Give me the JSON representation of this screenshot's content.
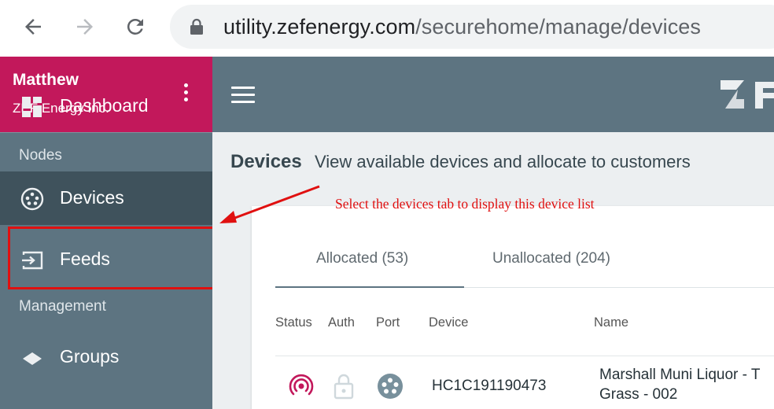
{
  "browser": {
    "url_host": "utility.zefenergy.com",
    "url_path": "/securehome/manage/devices",
    "icons": [
      "back-icon",
      "forward-icon",
      "reload-icon",
      "lock-icon"
    ]
  },
  "account": {
    "name": "Matthew",
    "org": "ZEF Energy Inc."
  },
  "sidebar": {
    "items": [
      {
        "label": "Dashboard",
        "icon": "dashboard-icon"
      },
      {
        "label": "Devices",
        "icon": "devices-icon",
        "active": true
      },
      {
        "label": "Feeds",
        "icon": "feeds-icon"
      },
      {
        "label": "Groups",
        "icon": "groups-icon"
      }
    ],
    "sections": {
      "nodes": "Nodes",
      "management": "Management"
    }
  },
  "page": {
    "title": "Devices",
    "subtitle": "View available devices and allocate to customers"
  },
  "annotation": {
    "text": "Select the devices tab to display this device list",
    "color": "#e01010"
  },
  "tabs": [
    {
      "label": "Allocated (53)",
      "active": true
    },
    {
      "label": "Unallocated (204)",
      "active": false
    }
  ],
  "table": {
    "columns": [
      "Status",
      "Auth",
      "Port",
      "Device",
      "Name"
    ],
    "rows": [
      {
        "status_icon": "signal-icon",
        "auth_icon": "lock-open-icon",
        "port_icon": "port-icon",
        "device": "HC1C191190473",
        "name_line1": "Marshall Muni Liquor - T",
        "name_line2": "Grass - 002"
      }
    ]
  },
  "colors": {
    "account_bg": "#c2185b",
    "sidebar_bg": "#5d7481",
    "sidebar_active": "#3f525c",
    "header_bg": "#5d7481",
    "status_icon": "#c2185b",
    "port_icon": "#78909c"
  }
}
